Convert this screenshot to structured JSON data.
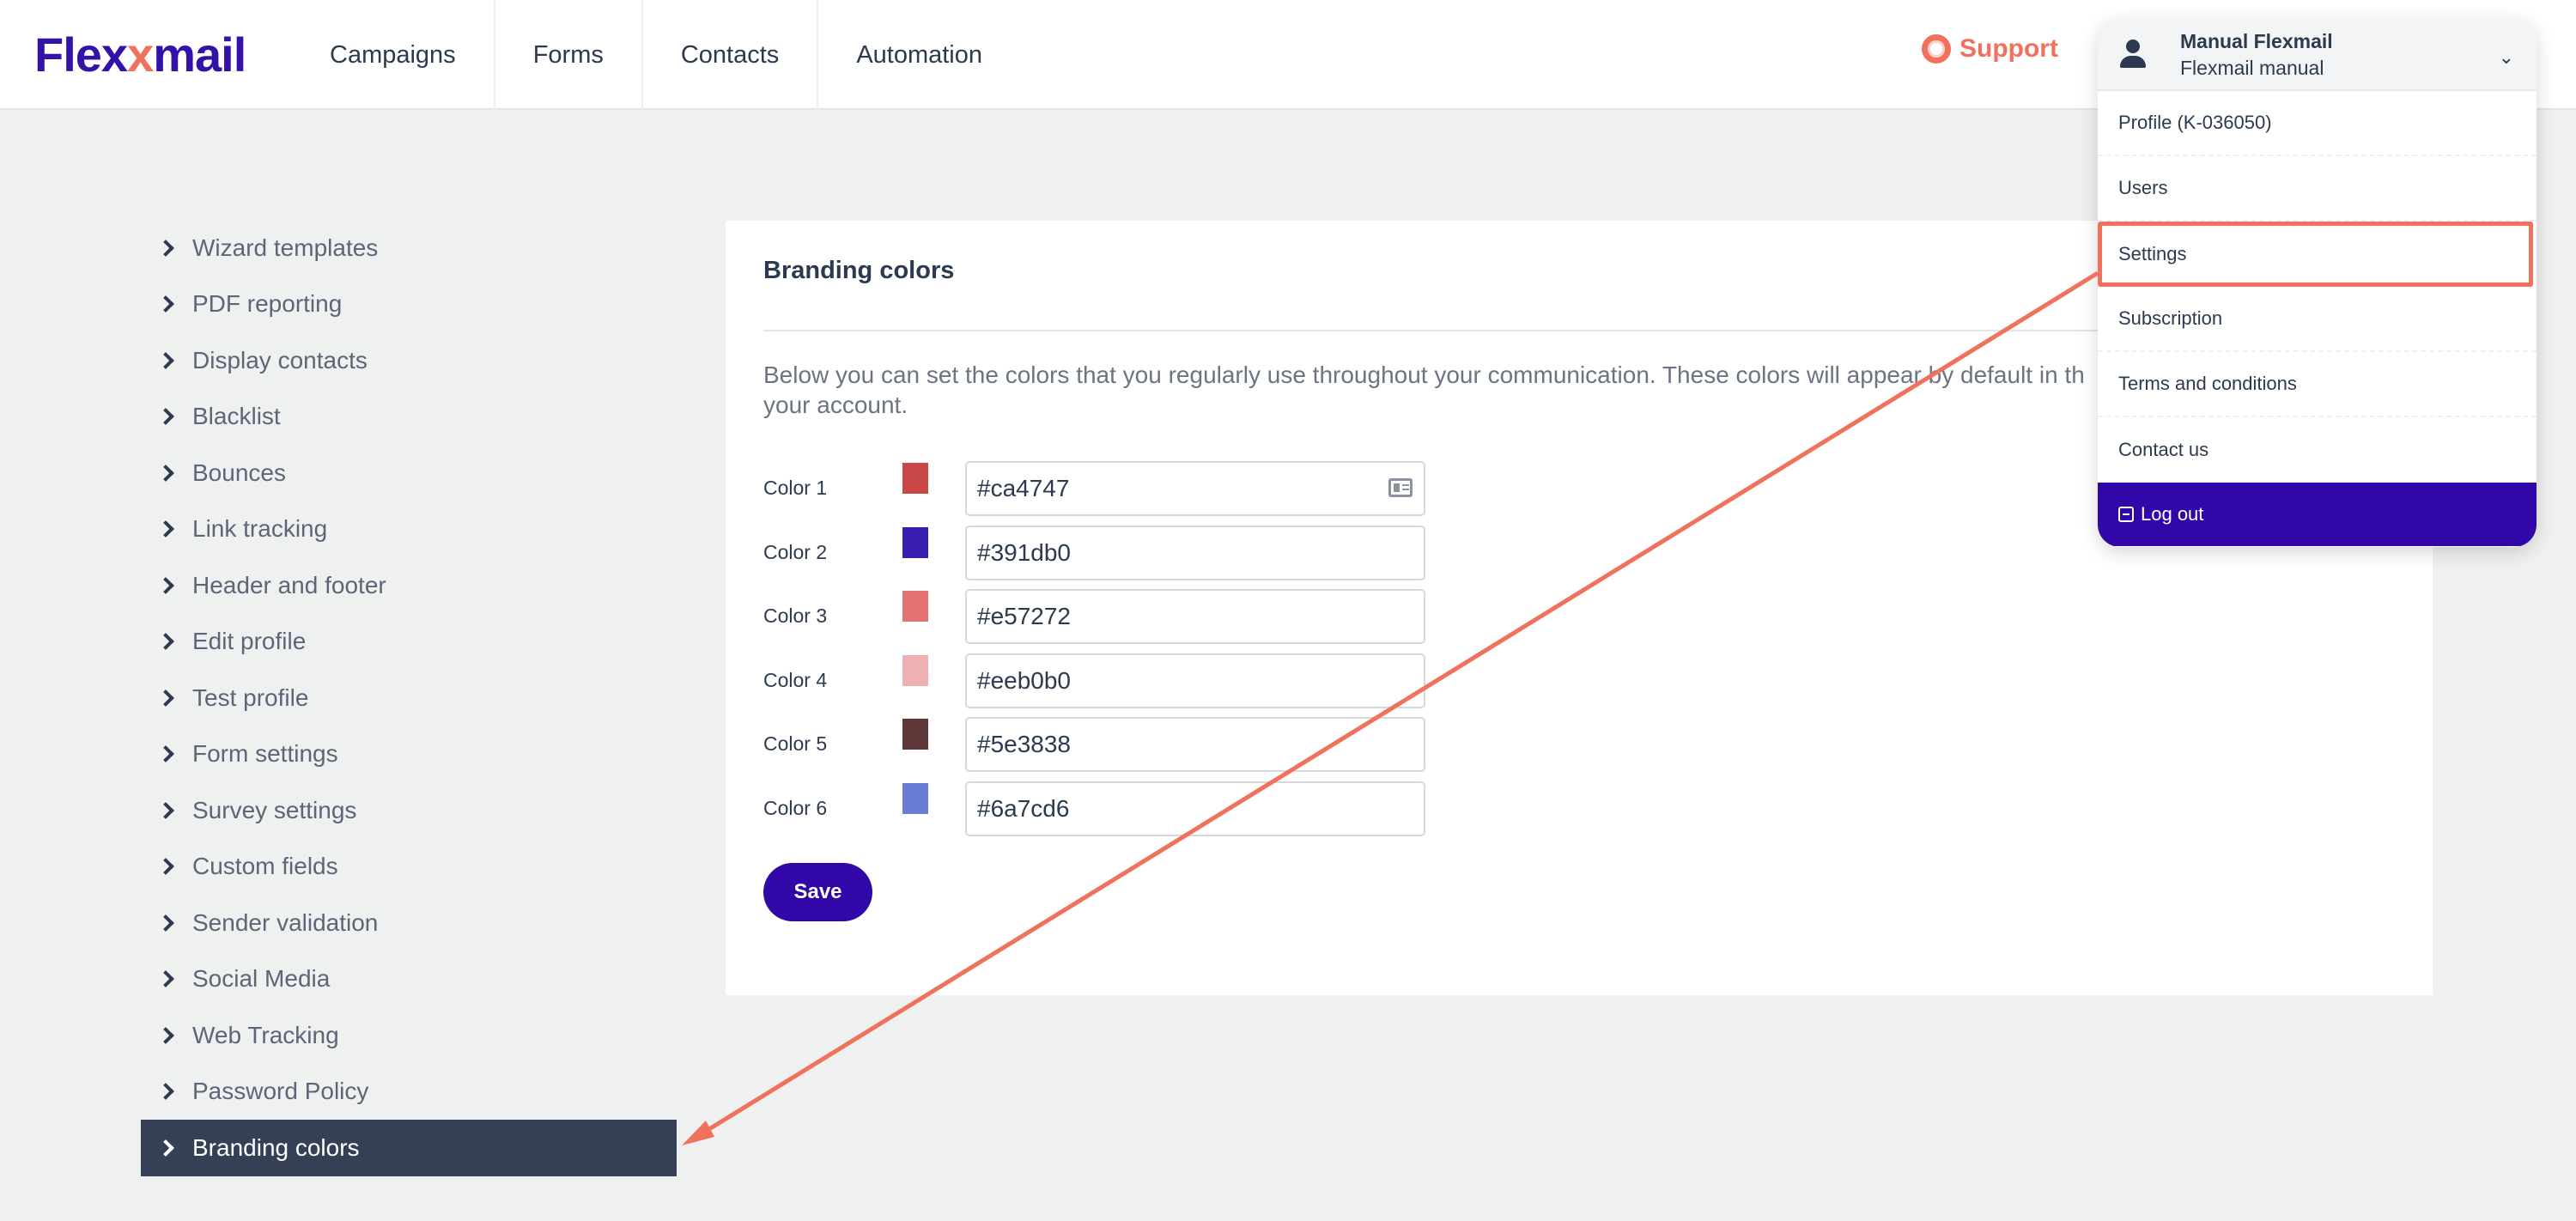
{
  "header": {
    "logo_left": "Flex",
    "logo_x": "x",
    "logo_right": "mail",
    "nav": [
      "Campaigns",
      "Forms",
      "Contacts",
      "Automation"
    ],
    "support_label": "Support",
    "support_icon": "lifebuoy-icon"
  },
  "account": {
    "name": "Manual Flexmail",
    "subtitle": "Flexmail manual",
    "menu": [
      "Profile (K-036050)",
      "Users",
      "Settings",
      "Subscription",
      "Terms and conditions",
      "Contact us"
    ],
    "highlighted": "Settings",
    "logout_label": "Log out"
  },
  "sidebar": {
    "items": [
      "Wizard templates",
      "PDF reporting",
      "Display contacts",
      "Blacklist",
      "Bounces",
      "Link tracking",
      "Header and footer",
      "Edit profile",
      "Test profile",
      "Form settings",
      "Survey settings",
      "Custom fields",
      "Sender validation",
      "Social Media",
      "Web Tracking",
      "Password Policy",
      "Branding colors"
    ],
    "active": "Branding colors"
  },
  "main": {
    "title": "Branding colors",
    "description": "Below you can set the colors that you regularly use throughout your communication. These colors will appear by default in th",
    "description_line2": "your account.",
    "colors": [
      {
        "label": "Color 1",
        "value": "#ca4747",
        "swatch": "#ca4747"
      },
      {
        "label": "Color 2",
        "value": "#391db0",
        "swatch": "#391db0"
      },
      {
        "label": "Color 3",
        "value": "#e57272",
        "swatch": "#e57272"
      },
      {
        "label": "Color 4",
        "value": "#eeb0b0",
        "swatch": "#eeb0b0"
      },
      {
        "label": "Color 5",
        "value": "#5e3838",
        "swatch": "#5e3838"
      },
      {
        "label": "Color 6",
        "value": "#6a7cd6",
        "swatch": "#6a7cd6"
      }
    ],
    "save_label": "Save"
  },
  "theme": {
    "brand": "#3207a7",
    "accent": "#f0725d",
    "sidebar_active": "#354057"
  }
}
